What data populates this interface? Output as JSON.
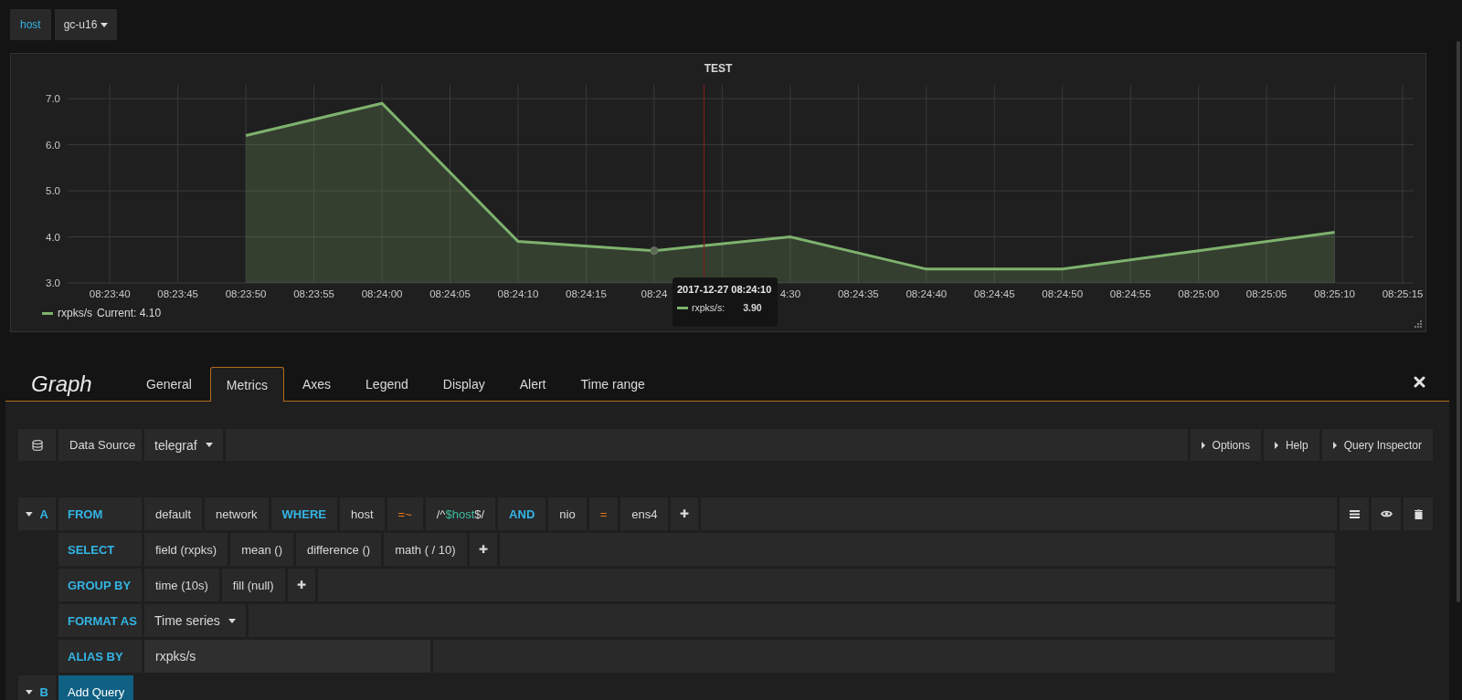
{
  "variables": [
    {
      "label": "host",
      "value": "gc-u16"
    }
  ],
  "panel": {
    "title": "TEST",
    "chart_data": {
      "type": "area",
      "grid": true,
      "categories": [
        "08:23:40",
        "08:23:45",
        "08:23:50",
        "08:23:55",
        "08:24:00",
        "08:24:05",
        "08:24:10",
        "08:24:15",
        "08:24",
        null,
        "4:30",
        "08:24:35",
        "08:24:40",
        "08:24:45",
        "08:24:50",
        "08:24:55",
        "08:25:00",
        "08:25:05",
        "08:25:10",
        "08:25:15"
      ],
      "series": [
        {
          "name": "rxpks/s",
          "color": "#7eb26d",
          "values": [
            null,
            null,
            6.2,
            null,
            6.9,
            null,
            3.9,
            null,
            3.7,
            null,
            4.0,
            null,
            3.3,
            null,
            3.3,
            null,
            3.7,
            null,
            4.1,
            null
          ]
        }
      ],
      "ylim": [
        3.0,
        7.3
      ],
      "yticks": [
        {
          "value": 3,
          "label": "3.0"
        },
        {
          "value": 4,
          "label": "4.0"
        },
        {
          "value": 5,
          "label": "5.0"
        },
        {
          "value": 6,
          "label": "6.0"
        },
        {
          "value": 7,
          "label": "7.0"
        }
      ]
    },
    "legend": [
      {
        "current": "Current: 4.10",
        "color": "#7eb26d"
      }
    ],
    "tooltip": {
      "time": "2017-12-27 08:24:10",
      "series": "rxpks/s:",
      "value": "3.90",
      "color": "#7eb26d"
    }
  },
  "editor": {
    "title": "Graph",
    "tabs": [
      {
        "label": "General",
        "selected": false
      },
      {
        "label": "Metrics",
        "selected": true
      },
      {
        "label": "Axes",
        "selected": false
      },
      {
        "label": "Legend",
        "selected": false
      },
      {
        "label": "Display",
        "selected": false
      },
      {
        "label": "Alert",
        "selected": false
      },
      {
        "label": "Time range",
        "selected": false
      }
    ],
    "datasource": {
      "label": "Data Source",
      "value": "telegraf"
    },
    "buttons": [
      "Options",
      "Help",
      "Query Inspector"
    ],
    "queries": [
      {
        "letter": "A",
        "rows": [
          {
            "keyword": "FROM",
            "kind": "segments",
            "segments": [
              {
                "kind": "value",
                "text": "default"
              },
              {
                "kind": "value",
                "text": "network"
              },
              {
                "kind": "keyword",
                "text": "WHERE"
              },
              {
                "kind": "value",
                "text": "host"
              },
              {
                "kind": "operator",
                "text": "=~"
              },
              {
                "kind": "template",
                "parts": [
                  {
                    "text": "/^",
                    "variable": false
                  },
                  {
                    "text": "$host",
                    "variable": true
                  },
                  {
                    "text": "$/",
                    "variable": false
                  }
                ]
              },
              {
                "kind": "keyword",
                "text": "AND"
              },
              {
                "kind": "value",
                "text": "nio"
              },
              {
                "kind": "operator",
                "text": "="
              },
              {
                "kind": "value",
                "text": "ens4"
              },
              {
                "kind": "plus",
                "text": "✚"
              }
            ]
          },
          {
            "keyword": "SELECT",
            "kind": "segments",
            "segments": [
              {
                "kind": "value",
                "text": "field (rxpks)"
              },
              {
                "kind": "value",
                "text": "mean ()"
              },
              {
                "kind": "value",
                "text": "difference ()"
              },
              {
                "kind": "value",
                "text": "math ( / 10)"
              },
              {
                "kind": "plus",
                "text": "✚"
              }
            ]
          },
          {
            "keyword": "GROUP BY",
            "kind": "segments",
            "segments": [
              {
                "kind": "value",
                "text": "time (10s)"
              },
              {
                "kind": "value",
                "text": "fill (null)"
              },
              {
                "kind": "plus",
                "text": "✚"
              }
            ]
          },
          {
            "keyword": "FORMAT AS",
            "kind": "select",
            "value": "Time series"
          },
          {
            "keyword": "ALIAS BY",
            "kind": "input",
            "value": "rxpks/s"
          }
        ]
      },
      {
        "letter": "B",
        "add_button": "Add Query"
      }
    ]
  }
}
